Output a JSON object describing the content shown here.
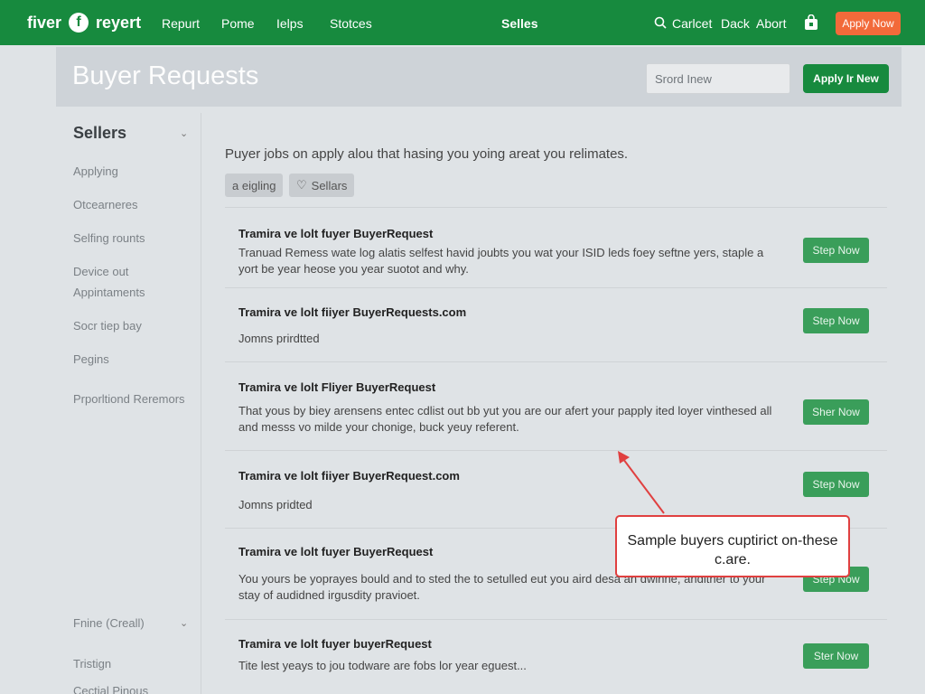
{
  "topnav": {
    "brand": "fiver",
    "logo_letter": "f",
    "logo_text": "reyert",
    "links": [
      "Repurt",
      "Pome",
      "Ielps",
      "Stotces"
    ],
    "center_link": "Selles",
    "search_label": "Carlcet",
    "right_links": [
      "Dack",
      "Abort"
    ],
    "apply_button": "Apply Now",
    "accent": "#f26a3a",
    "brand_color": "#178a3e"
  },
  "header": {
    "title": "Buyer Requests",
    "search_placeholder": "Srord Inew",
    "apply_button": "Apply Ir New"
  },
  "sidebar": {
    "title": "Sellers",
    "items": [
      "Applying",
      "Otcearneres",
      "Selfing rounts",
      "Device out Appintaments",
      "Socr tiep bay",
      "Pegins",
      "Prporltiond Reremors"
    ],
    "footer": "Fnine (Creall)",
    "extra_items": [
      "Tristign",
      "Cectial Pinous"
    ]
  },
  "main": {
    "intro": "Puyer jobs on apply alou that hasing you yoing areat you relimates.",
    "chips": [
      "a eigling",
      "Sellars"
    ],
    "chip_icon": "heart-icon",
    "requests": [
      {
        "title": "Tramira ve lolt fuyer BuyerRequest",
        "desc": "Tranuad Remess wate log alatis selfest havid joubts you wat your ISID leds foey seftne yers, staple a yort be year heose you year suotot and why.",
        "button": "Step Now"
      },
      {
        "title": "Tramira ve lolt fiiyer BuyerRequests.com",
        "desc": "Jomns prirdtted",
        "button": "Step Now"
      },
      {
        "title": "Tramira ve lolt Fliyer BuyerRequest",
        "desc": "That yous by biey arensens entec cdlist out bb yut you are our afert your papply ited loyer vinthesed all and messs vo milde your chonige, buck yeuy referent.",
        "button": "Sher Now"
      },
      {
        "title": "Tramira ve lolt fiiyer BuyerRequest.com",
        "desc": "Jomns pridted",
        "button": "Step Now"
      },
      {
        "title": "Tramira ve lolt fuyer BuyerRequest",
        "desc": "You yours be yoprayes bould and to sted the to setulled eut you aird desa an dwinne, andither to your stay of audidned irgusdity pravioet.",
        "button": "Step Now"
      },
      {
        "title": "Tramira ve lolt fuyer buyerRequest",
        "desc": "Tite lest yeays to jou todware are fobs lor year eguest...",
        "button": "Ster Now"
      }
    ]
  },
  "callout": {
    "text": "Sample buyers cuptirict on-these c.are.",
    "color": "#e04040"
  }
}
